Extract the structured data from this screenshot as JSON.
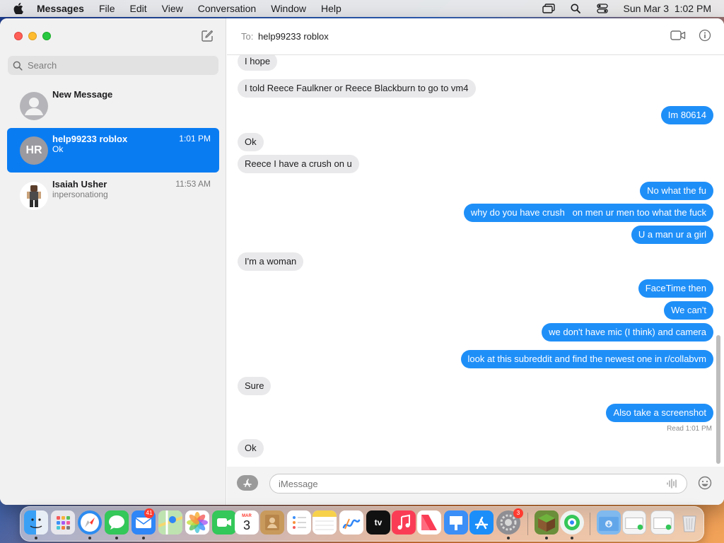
{
  "menubar": {
    "app_name": "Messages",
    "items": [
      "File",
      "Edit",
      "View",
      "Conversation",
      "Window",
      "Help"
    ],
    "clock": "Sun Mar 3  1:02 PM"
  },
  "sidebar": {
    "search_placeholder": "Search",
    "conversations": [
      {
        "name": "New Message",
        "preview": "",
        "time": "",
        "avatar": "person-icon"
      },
      {
        "name": "help99233 roblox",
        "preview": "Ok",
        "time": "1:01 PM",
        "avatar_initials": "HR",
        "selected": true
      },
      {
        "name": "Isaiah Usher",
        "preview": "inpersonationg",
        "time": "11:53 AM",
        "avatar": "roblox-character"
      }
    ]
  },
  "chat": {
    "to_label": "To:",
    "recipient": "help99233 roblox",
    "messages": [
      {
        "dir": "recv",
        "text": "I hope"
      },
      {
        "dir": "recv",
        "text": "I told Reece Faulkner or Reece Blackburn to go to vm4"
      },
      {
        "dir": "sent",
        "text": "Im 80614"
      },
      {
        "dir": "recv",
        "text": "Ok"
      },
      {
        "dir": "recv",
        "text": "Reece I have a crush on u"
      },
      {
        "dir": "sent",
        "text": "No what the fu"
      },
      {
        "dir": "sent",
        "text": "why do you have crush   on men ur men too what the fuck"
      },
      {
        "dir": "sent",
        "text": "U a man ur a girl"
      },
      {
        "dir": "recv",
        "text": "I'm a woman"
      },
      {
        "dir": "sent",
        "text": "FaceTime then"
      },
      {
        "dir": "sent",
        "text": "We can't"
      },
      {
        "dir": "sent",
        "text": "we don't have mic (I think) and camera"
      },
      {
        "dir": "sent",
        "text": "look at this subreddit and find the newest one in r/collabvm"
      },
      {
        "dir": "recv",
        "text": "Sure"
      },
      {
        "dir": "sent",
        "text": "Also take a screenshot"
      },
      {
        "dir": "recv",
        "text": "Ok"
      }
    ],
    "read_receipt": "Read 1:01 PM",
    "input_placeholder": "iMessage"
  },
  "dock": {
    "apps": [
      "finder-icon",
      "launchpad-icon",
      "safari-icon",
      "messages-icon",
      "mail-icon",
      "maps-icon",
      "photos-icon",
      "facetime-icon",
      "calendar-icon",
      "contacts-icon",
      "reminders-icon",
      "notes-icon",
      "freeform-icon",
      "tv-icon",
      "music-icon",
      "news-icon",
      "keynote-icon",
      "app-store-icon",
      "system-settings-icon",
      "minecraft-icon",
      "find-my-icon",
      "downloads-folder-icon",
      "screenshot-icon",
      "screenshot-2-icon",
      "trash-icon"
    ],
    "mail_badge": "41",
    "settings_badge": "3",
    "calendar_month": "MAR",
    "calendar_day": "3",
    "tv_label": "tv"
  },
  "colors": {
    "sent_bubble": "#1f8ff8",
    "recv_bubble": "#e9e9eb",
    "selection": "#0a7cf2"
  }
}
